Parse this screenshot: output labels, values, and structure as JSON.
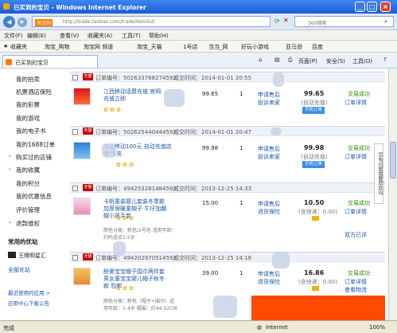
{
  "window": {
    "title": "已买到的宝贝 - Windows Internet Explorer"
  },
  "address": {
    "url": "http://trade.taobao.com/trade/itemlist/",
    "site_label": "淘宝网",
    "search_placeholder": "360搜索"
  },
  "menu": {
    "items": [
      "文件(F)",
      "编辑(E)",
      "查看(V)",
      "收藏夹(A)",
      "工具(T)",
      "帮助(H)"
    ]
  },
  "favorites": {
    "label": "收藏夹",
    "items": [
      "淘宝_购物",
      "淘宝网 频道",
      "淘宝_天猫",
      "1号店",
      "当当_网",
      "好玩小游戏",
      "亚马逊",
      "百度"
    ]
  },
  "tab": {
    "title": "已买到的宝贝",
    "tools": [
      "页面(P)",
      "安全(S)",
      "工具(O)"
    ]
  },
  "sidebar": {
    "items": [
      "我的拍卖",
      "机票酒店保险",
      "我的彩票",
      "我的游戏",
      "我的电子书",
      "我的1688订单",
      "购买过的店铺",
      "我的收藏",
      "我的积分",
      "我的优惠信息",
      "评价管理",
      "退款维权"
    ],
    "section_title": "常用的优站",
    "shop_name": "王牌明星汇",
    "all_shops": "全部优站",
    "recent_apps": "最近使用的应用 >",
    "app_center": "应用中心下载公告"
  },
  "orders": [
    {
      "order_label": "订单编号：502633768274592",
      "time": "成交时间：2014-01-01 20:55",
      "title": "江西移动话费充值 官网充值立即",
      "price": "99.65",
      "qty": "1",
      "after": [
        "申请售后",
        "投诉卖家"
      ],
      "total": "99.65",
      "total_note": "(自动充值)",
      "btn": "手机订单",
      "status": "交易成功",
      "detail": "订单详情",
      "tag": "天猫"
    },
    {
      "order_label": "订单编号：502625440444592",
      "time": "成交时间：2014-01-01 20:47",
      "title": "中国移动100元 自动充值店铺 快充",
      "price": "99.98",
      "qty": "1",
      "after": [
        "申请售后",
        "投诉卖家"
      ],
      "total": "99.98",
      "total_note": "(自动充值)",
      "btn": "手机订单",
      "status": "交易成功",
      "detail": "订单详情",
      "tag": "天猫"
    },
    {
      "order_label": "订单编号：494253281484592",
      "time": "成交时间：2013-12-25 14:33",
      "title": "卡帆童装婴儿套装冬季款加厚保暖童帽子 牛仔加翻帽小孩手套",
      "spec": "颜色分类：粉色/2号色 适用年龄：",
      "spec2": "约码适合1-5岁",
      "price": "15.00",
      "qty": "1",
      "after": [
        "申请售后",
        "退货保险"
      ],
      "total": "10.50",
      "total_note": "(含快递：0.00)",
      "status": "交易成功",
      "detail": "订单详情",
      "extra": "双方已评",
      "tag": "天猫"
    },
    {
      "order_label": "订单编号：494202970514592",
      "time": "成交时间：2013-12-25 14:18",
      "title": "醉爱宝宝帽子围巾两件套男女童宝宝婴儿帽子秋冬款 包邮",
      "spec": "颜色分类：粉色（帽子+围巾）适",
      "spec2": "用年龄：1-4岁 帽围：约44-52CM",
      "price": "39.00",
      "qty": "1",
      "after": [
        "申请售后",
        "退货保险"
      ],
      "total": "16.86",
      "total_note": "(含快递：0.00)",
      "status": "交易成功",
      "detail": "订单详情",
      "extra": "查看物流",
      "tag": "天猫"
    }
  ],
  "side_tip": "您有问题需要帮助吗",
  "status": {
    "left": "完成",
    "zone": "Internet",
    "zoom": "100%"
  }
}
